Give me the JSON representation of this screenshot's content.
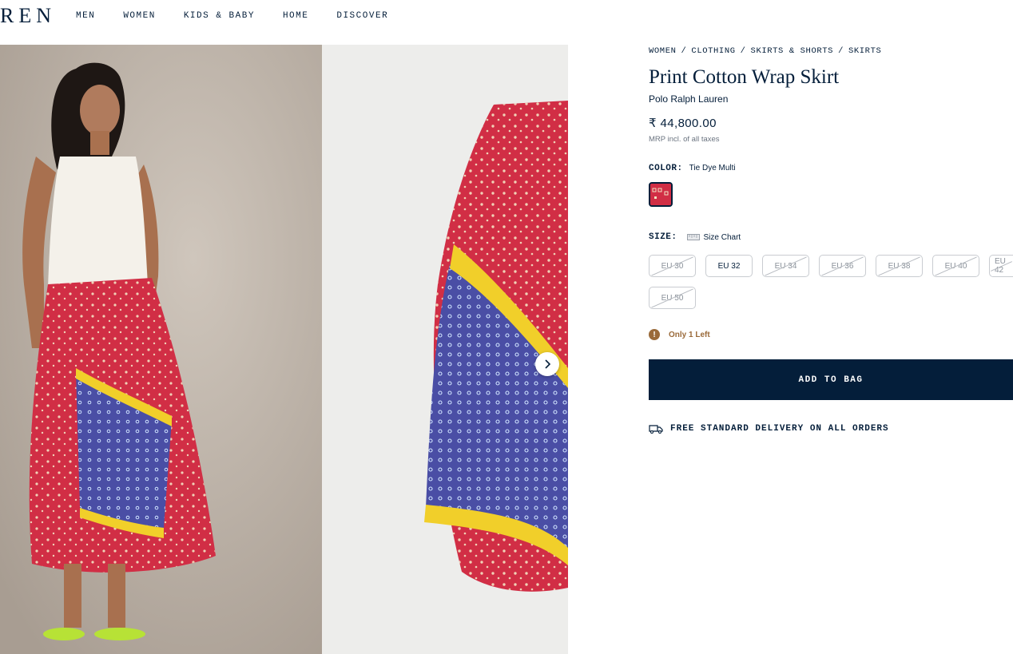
{
  "header": {
    "logo": "REN",
    "nav": [
      "MEN",
      "WOMEN",
      "KIDS & BABY",
      "HOME",
      "DISCOVER"
    ]
  },
  "breadcrumb": [
    "WOMEN",
    "CLOTHING",
    "SKIRTS & SHORTS",
    "SKIRTS"
  ],
  "product": {
    "title": "Print Cotton Wrap Skirt",
    "brand": "Polo Ralph Lauren",
    "price": "₹ 44,800.00",
    "tax_note": "MRP incl. of all taxes",
    "color_label": "COLOR:",
    "color_value": "Tie Dye Multi",
    "swatch_color": "#d12e45",
    "size_label": "SIZE:",
    "size_chart": "Size Chart",
    "sizes": [
      {
        "label": "EU 30",
        "available": false
      },
      {
        "label": "EU 32",
        "available": true
      },
      {
        "label": "EU 34",
        "available": false
      },
      {
        "label": "EU 36",
        "available": false
      },
      {
        "label": "EU 38",
        "available": false
      },
      {
        "label": "EU 40",
        "available": false
      },
      {
        "label": "EU 42",
        "available": false
      },
      {
        "label": "EU 50",
        "available": false
      }
    ],
    "stock_message": "Only 1 Left",
    "add_to_bag": "ADD TO BAG",
    "delivery": "FREE STANDARD DELIVERY ON ALL ORDERS"
  },
  "colors": {
    "navy": "#041e3a",
    "skirt_red": "#d12e45",
    "skirt_blue": "#4a4ea5",
    "skirt_yellow": "#f1cf2a",
    "warning": "#9a6a3a"
  }
}
